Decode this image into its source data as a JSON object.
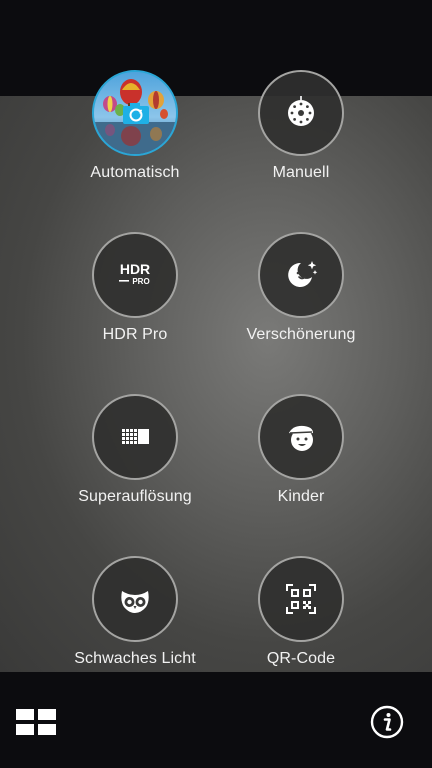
{
  "modes": [
    {
      "label": "Automatisch",
      "icon": "auto-camera-icon",
      "active": true
    },
    {
      "label": "Manuell",
      "icon": "manual-dial-icon",
      "active": false
    },
    {
      "label": "HDR Pro",
      "icon": "hdr-pro-icon",
      "active": false
    },
    {
      "label": "Verschönerung",
      "icon": "beautify-icon",
      "active": false
    },
    {
      "label": "Superauflösung",
      "icon": "super-resolution-icon",
      "active": false
    },
    {
      "label": "Kinder",
      "icon": "kids-face-icon",
      "active": false
    },
    {
      "label": "Schwaches Licht",
      "icon": "owl-icon",
      "active": false
    },
    {
      "label": "QR-Code",
      "icon": "qr-code-icon",
      "active": false
    }
  ],
  "hdr_icon_text": {
    "top": "HDR",
    "bottom": "PRO"
  },
  "bottom_bar": {
    "grid_icon": "grid-icon",
    "info_icon": "info-icon"
  },
  "colors": {
    "accent": "#2aa6d6",
    "label": "#f2f2f2",
    "ring": "#a4a4a2"
  }
}
